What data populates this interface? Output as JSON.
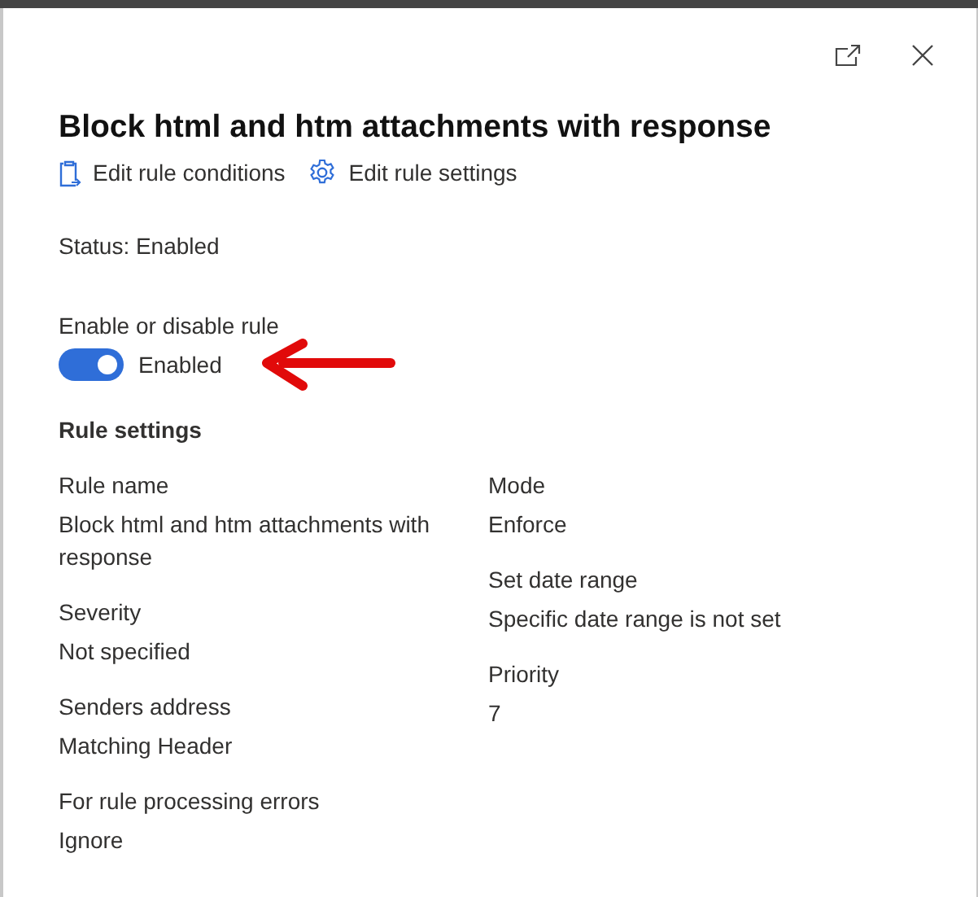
{
  "panel": {
    "title": "Block html and htm attachments with response",
    "actions": [
      {
        "kind": "conditions",
        "label": "Edit rule conditions"
      },
      {
        "kind": "settings",
        "label": "Edit rule settings"
      }
    ],
    "status": "Status: Enabled",
    "toggle": {
      "label": "Enable or disable rule",
      "on": true,
      "text": "Enabled"
    },
    "section_title": "Rule settings",
    "columns": [
      [
        {
          "label": "Rule name",
          "value": "Block html and htm attachments with response"
        },
        {
          "label": "Severity",
          "value": "Not specified"
        },
        {
          "label": "Senders address",
          "value": "Matching Header"
        },
        {
          "label": "For rule processing errors",
          "value": "Ignore"
        }
      ],
      [
        {
          "label": "Mode",
          "value": "Enforce"
        },
        {
          "label": "Set date range",
          "value": "Specific date range is not set"
        },
        {
          "label": "Priority",
          "value": "7"
        }
      ]
    ]
  }
}
